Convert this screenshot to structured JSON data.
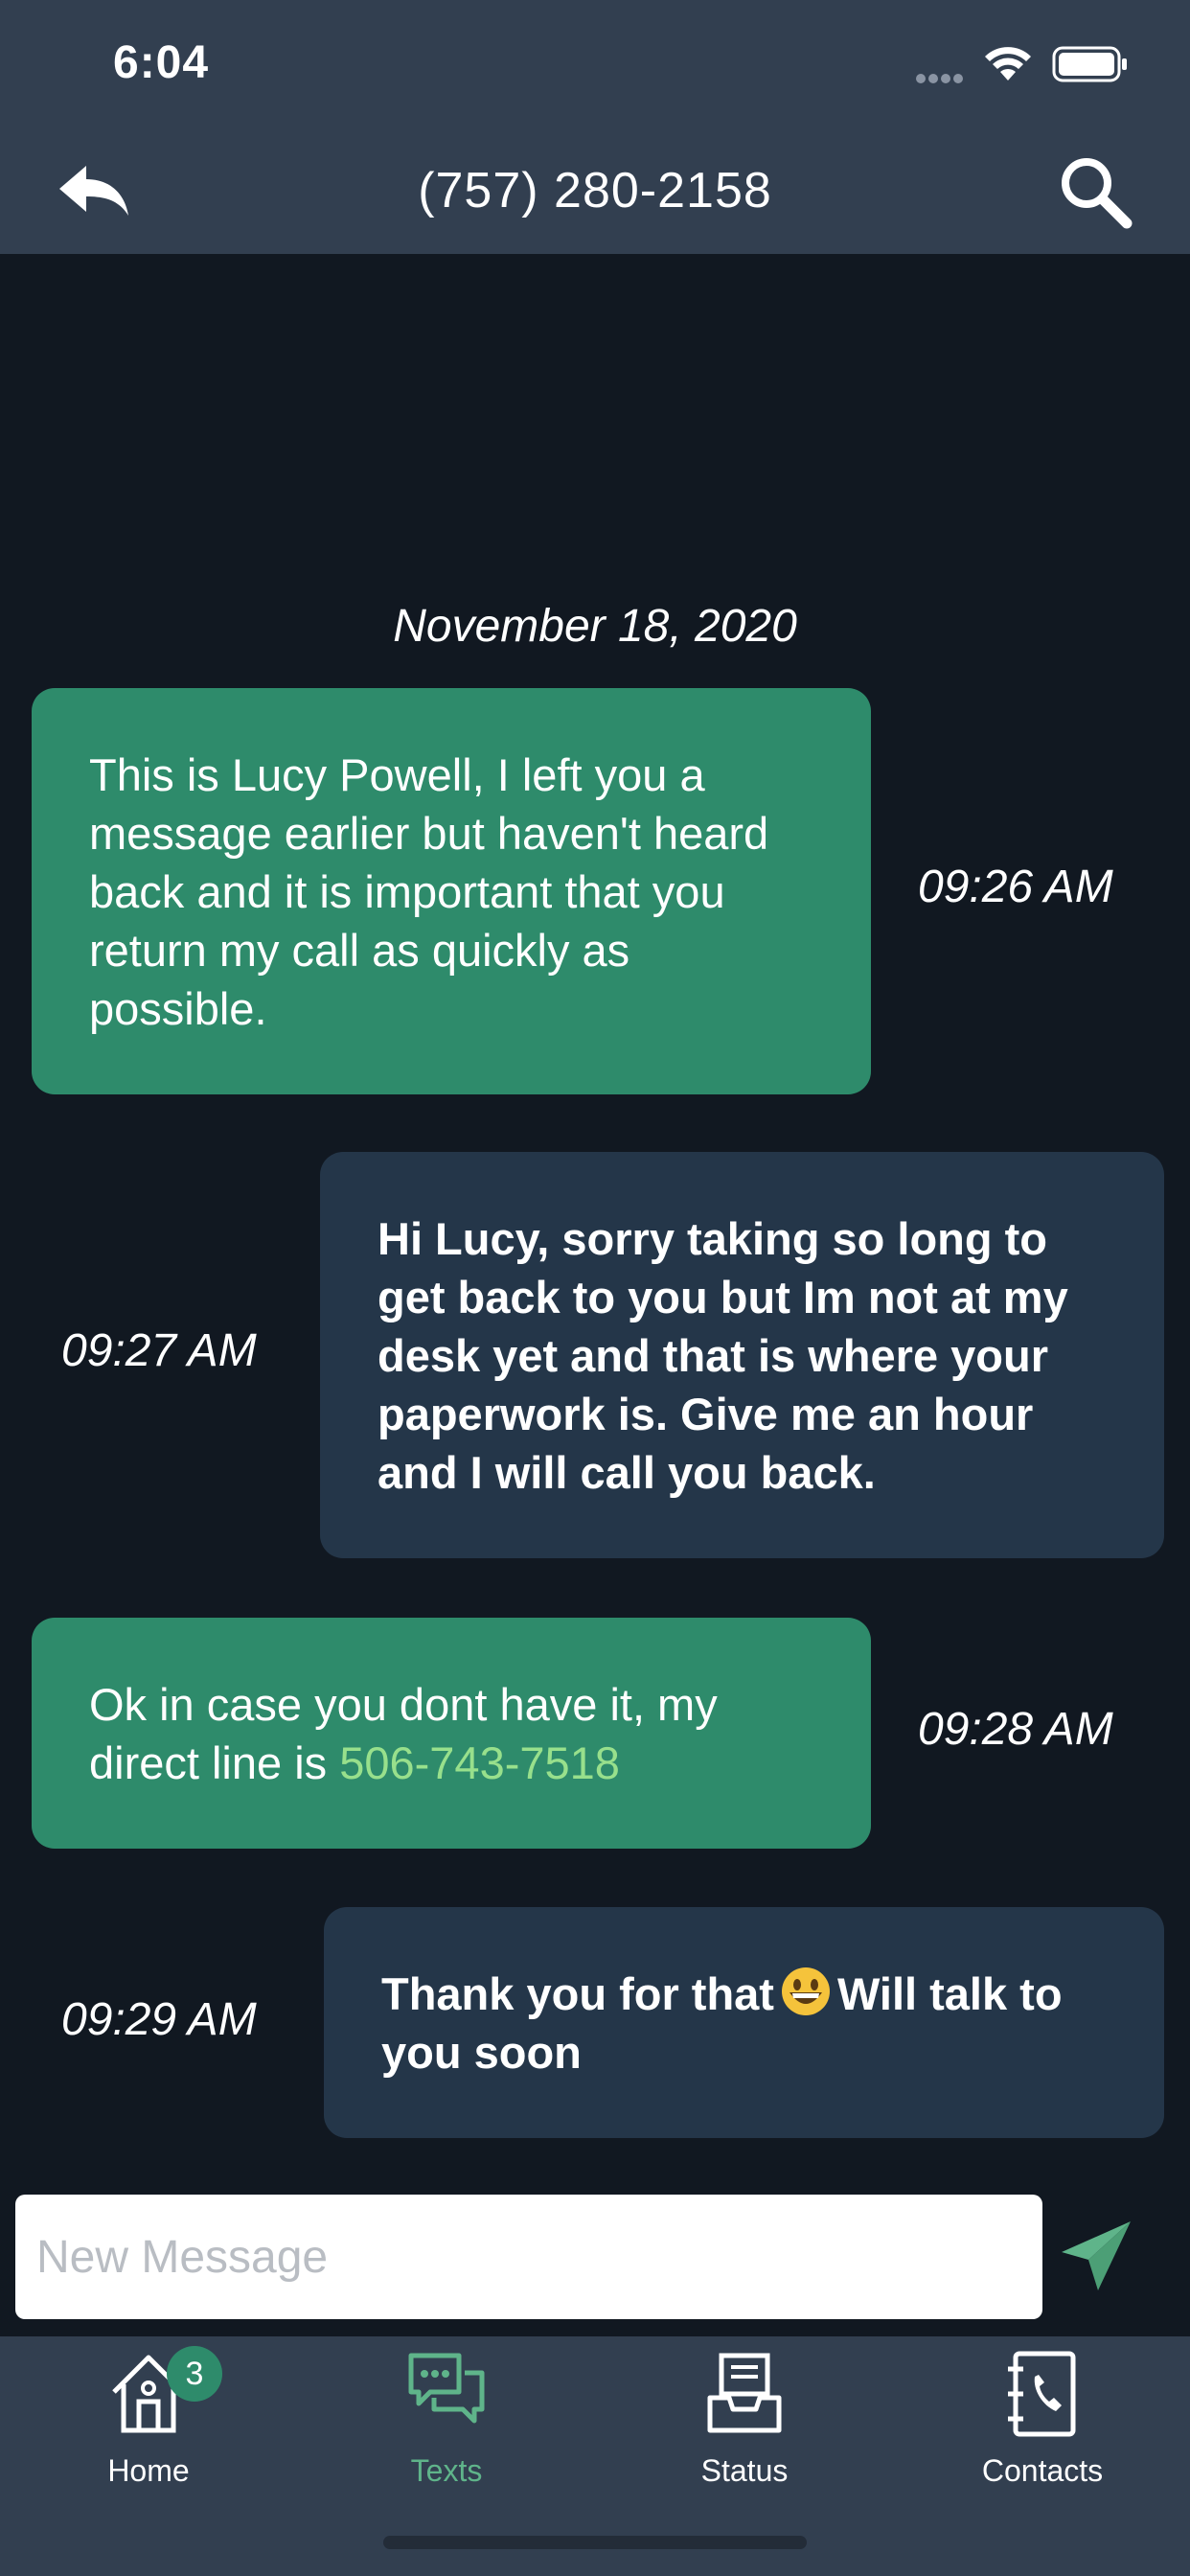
{
  "status_bar": {
    "time": "6:04"
  },
  "header": {
    "title": "(757) 280-2158",
    "back_icon": "reply-arrow-icon",
    "search_icon": "search-icon"
  },
  "conversation": {
    "date": "November 18, 2020",
    "messages": [
      {
        "direction": "incoming",
        "text": "This is Lucy Powell, I left you a message earlier but haven't heard back and it is important that you return my call as quickly as possible.",
        "time": "09:26 AM"
      },
      {
        "direction": "outgoing",
        "text": "Hi Lucy, sorry taking so long to get back to you but Im not at my desk yet and that is where your paperwork is. Give me an hour and I will call you back.",
        "time": "09:27 AM"
      },
      {
        "direction": "incoming",
        "text_before_link": "Ok in case you dont have it, my direct line is ",
        "link": "506-743-7518",
        "time": "09:28 AM"
      },
      {
        "direction": "outgoing",
        "text_before_emoji": "Thank you for that",
        "emoji": "grinning-face-emoji",
        "text_after_emoji": "Will talk to you soon",
        "time": "09:29 AM"
      }
    ]
  },
  "compose": {
    "placeholder": "New Message",
    "value": ""
  },
  "tabs": [
    {
      "label": "Home",
      "icon": "house-icon",
      "badge": "3",
      "active": false
    },
    {
      "label": "Texts",
      "icon": "chat-bubbles-icon",
      "active": true
    },
    {
      "label": "Status",
      "icon": "inbox-tray-icon",
      "active": false
    },
    {
      "label": "Contacts",
      "icon": "address-book-icon",
      "active": false
    }
  ],
  "colors": {
    "bar_bg": "#323f50",
    "screen_bg": "#111821",
    "incoming_bubble": "#2e8b6b",
    "outgoing_bubble": "#243649",
    "link": "#98e08c",
    "accent": "#5fb48a"
  }
}
